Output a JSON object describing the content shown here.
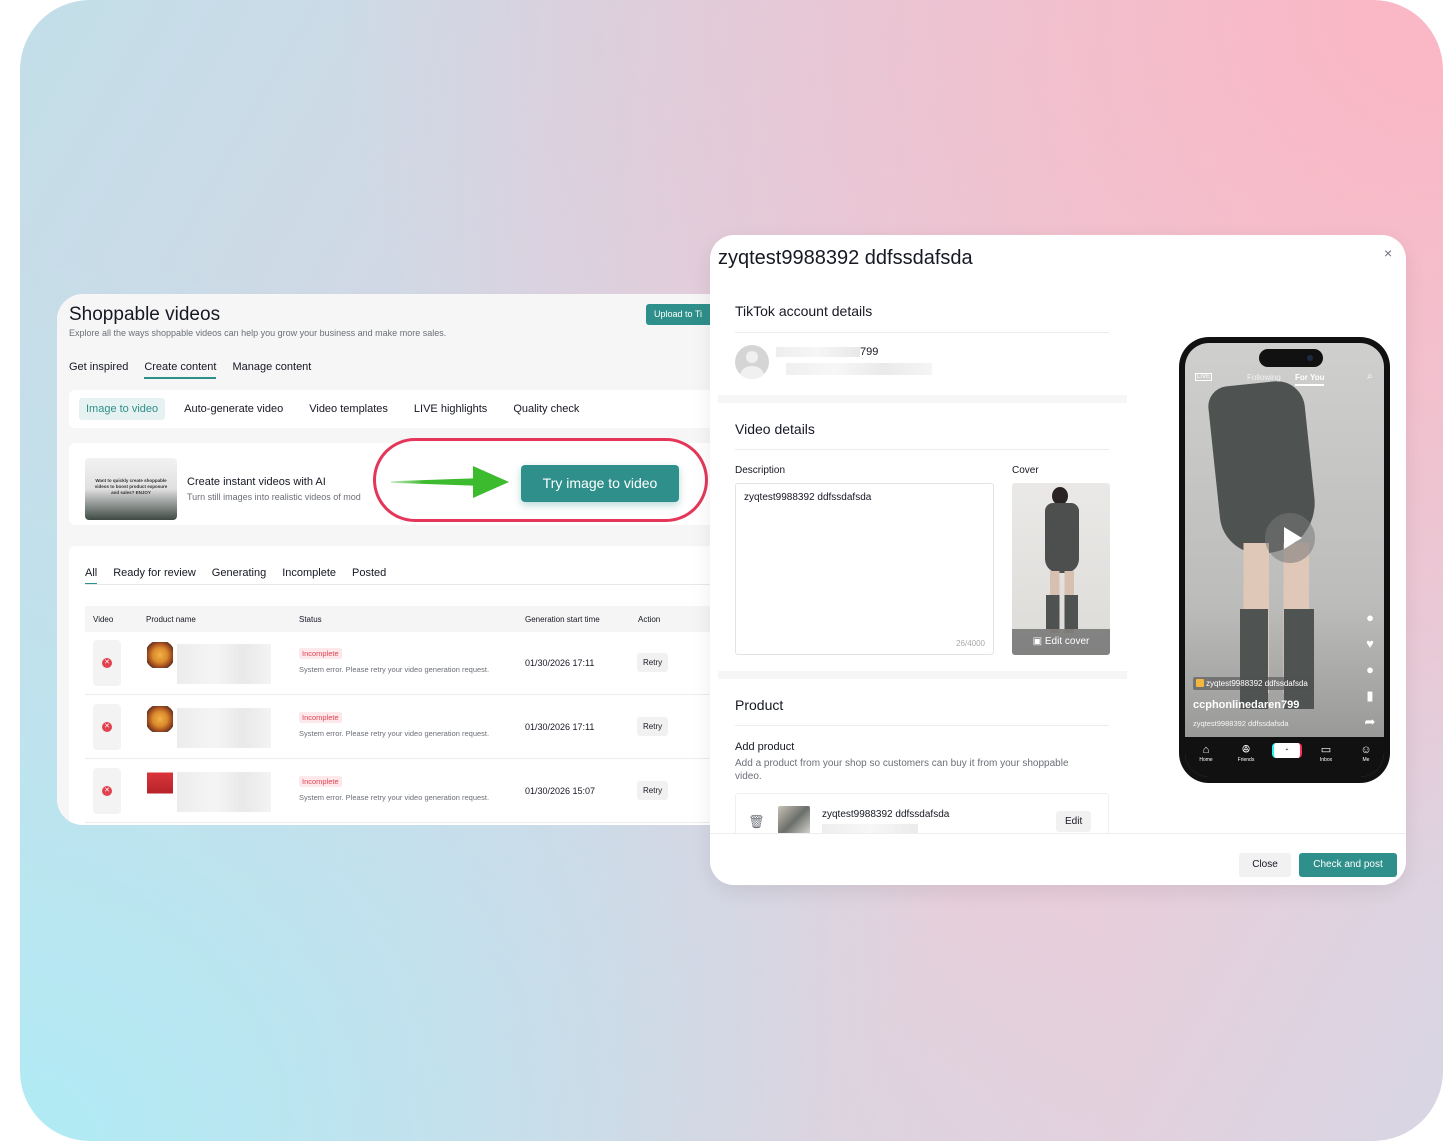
{
  "shoppable": {
    "title": "Shoppable videos",
    "subtitle": "Explore all the ways shoppable videos can help you grow your business and make more sales.",
    "upload_label": "Upload to Ti",
    "top_tabs": [
      "Get inspired",
      "Create content",
      "Manage content"
    ],
    "sub_tabs": [
      "Image to video",
      "Auto-generate video",
      "Video templates",
      "LIVE highlights",
      "Quality check"
    ],
    "promo": {
      "thumb_text": "Want to quickly create shoppable videos to boost product exposure and sales? ENJOY",
      "title": "Create instant videos with AI",
      "desc": "Turn still images into realistic videos of mod",
      "cta": "Try image to video"
    },
    "status_tabs": [
      "All",
      "Ready for review",
      "Generating",
      "Incomplete",
      "Posted"
    ],
    "table": {
      "columns": [
        "Video",
        "Product name",
        "Status",
        "Generation start time",
        "Action"
      ],
      "rows": [
        {
          "status": "Incomplete",
          "error": "System error. Please retry your video generation request.",
          "time": "01/30/2026 17:11",
          "action": "Retry"
        },
        {
          "status": "Incomplete",
          "error": "System error. Please retry your video generation request.",
          "time": "01/30/2026 17:11",
          "action": "Retry"
        },
        {
          "status": "Incomplete",
          "error": "System error. Please retry your video generation request.",
          "time": "01/30/2026 15:07",
          "action": "Retry"
        }
      ]
    }
  },
  "modal": {
    "title": "zyqtest9988392 ddfssdafsda",
    "close_icon": "×",
    "account_section": "TikTok account details",
    "account_name_suffix": "799",
    "video_section": "Video details",
    "description_label": "Description",
    "description_value": "zyqtest9988392 ddfssdafsda",
    "char_count": "26/4000",
    "cover_label": "Cover",
    "edit_cover": "Edit cover",
    "product_section": "Product",
    "add_product_label": "Add product",
    "add_product_desc": "Add a product from your shop so customers can buy it from your shoppable video.",
    "product_name": "zyqtest9988392 ddfssdafsda",
    "product_edit": "Edit",
    "close_button": "Close",
    "post_button": "Check and post"
  },
  "phone": {
    "live": "LIVE",
    "following": "Following",
    "for_you": "For You",
    "product_tag": "zyqtest9988392 ddfssdafsda",
    "username": "ccphonlinedaren799",
    "caption": "zyqtest9988392 ddfssdafsda",
    "nav": [
      "Home",
      "Friends",
      "Inbox",
      "Me"
    ]
  },
  "colors": {
    "brand": "#2f8f8a",
    "highlight": "#e5365a",
    "arrow": "#3dbb2f",
    "error": "#e4414f"
  }
}
